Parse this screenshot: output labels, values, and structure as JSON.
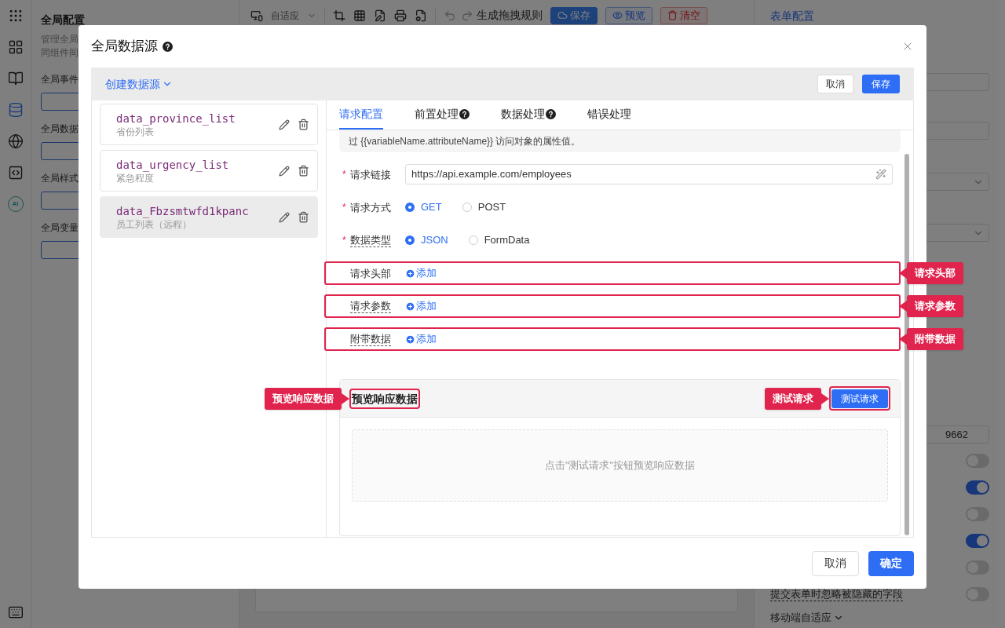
{
  "rail": [
    {
      "kind": "apps",
      "selected": false
    },
    {
      "kind": "components",
      "selected": false
    },
    {
      "kind": "book",
      "selected": false
    },
    {
      "kind": "database",
      "selected": true
    },
    {
      "kind": "globe",
      "selected": false
    },
    {
      "kind": "code",
      "selected": false
    },
    {
      "kind": "ai",
      "label": "AI",
      "selected": false
    },
    {
      "kind": "keyboard",
      "selected": false
    }
  ],
  "config_panel": {
    "title": "全局配置",
    "description": [
      "管理全局",
      "同组件间"
    ],
    "sections": [
      "全局事件",
      "全局数据",
      "全局样式",
      "全局变量"
    ]
  },
  "toolbar": {
    "device_mode": "自适应",
    "generate_label": "生成拖拽规则",
    "buttons": [
      {
        "kind": "primary",
        "label": "保存"
      },
      {
        "kind": "outline",
        "label": "预览"
      },
      {
        "kind": "danger",
        "label": "清空"
      }
    ]
  },
  "form_panel": {
    "title": "表单配置",
    "field_value": "9662",
    "switches": [
      {
        "on": false
      },
      {
        "on": true
      },
      {
        "on": false
      },
      {
        "on": true
      },
      {
        "on": false
      },
      {
        "on": false,
        "label": "提交表单时忽略被隐藏的字段"
      }
    ],
    "mobile_label": "移动端自适应"
  },
  "dialog": {
    "title": "全局数据源",
    "create_label": "创建数据源",
    "cancel": "取消",
    "save": "保存",
    "sources": [
      {
        "name": "data_province_list",
        "description": "省份列表",
        "selected": false
      },
      {
        "name": "data_urgency_list",
        "description": "紧急程度",
        "selected": false
      },
      {
        "name": "data_Fbzsmtwfd1kpanc",
        "description": "员工列表（远程）",
        "selected": true
      }
    ],
    "tabs": [
      {
        "label": "请求配置",
        "help": false,
        "selected": true
      },
      {
        "label": "前置处理",
        "help": true,
        "selected": false
      },
      {
        "label": "数据处理",
        "help": true,
        "selected": false
      },
      {
        "label": "错误处理",
        "help": false,
        "selected": false
      }
    ],
    "tip": "过 {{variableName.attributeName}} 访问对象的属性值。",
    "rows": [
      {
        "kind": "input",
        "label": "请求链接",
        "marker": "*",
        "dashed": false,
        "value": "https://api.example.com/employees"
      },
      {
        "kind": "radio",
        "label": "请求方式",
        "marker": "*",
        "dashed": false,
        "options": [
          {
            "label": "GET",
            "selected": true
          },
          {
            "label": "POST",
            "selected": false
          }
        ]
      },
      {
        "kind": "radio",
        "label": "数据类型",
        "marker": "*",
        "dashed": true,
        "options": [
          {
            "label": "JSON",
            "selected": true
          },
          {
            "label": "FormData",
            "selected": false
          }
        ]
      },
      {
        "kind": "add",
        "label": "请求头部",
        "dashed": false,
        "add_label": "添加",
        "highlighted": true,
        "callout": "请求头部"
      },
      {
        "kind": "add",
        "label": "请求参数",
        "dashed": true,
        "add_label": "添加",
        "highlighted": true,
        "callout": "请求参数"
      },
      {
        "kind": "add",
        "label": "附带数据",
        "dashed": true,
        "add_label": "添加",
        "highlighted": true,
        "callout": "附带数据"
      }
    ],
    "preview": {
      "title": "预览响应数据",
      "title_callout": "预览响应数据",
      "test_button": "测试请求",
      "button_callout": "测试请求",
      "empty_text": "点击\"测试请求\"按钮预览响应数据"
    },
    "footer": {
      "cancel": "取消",
      "ok": "确定"
    }
  }
}
